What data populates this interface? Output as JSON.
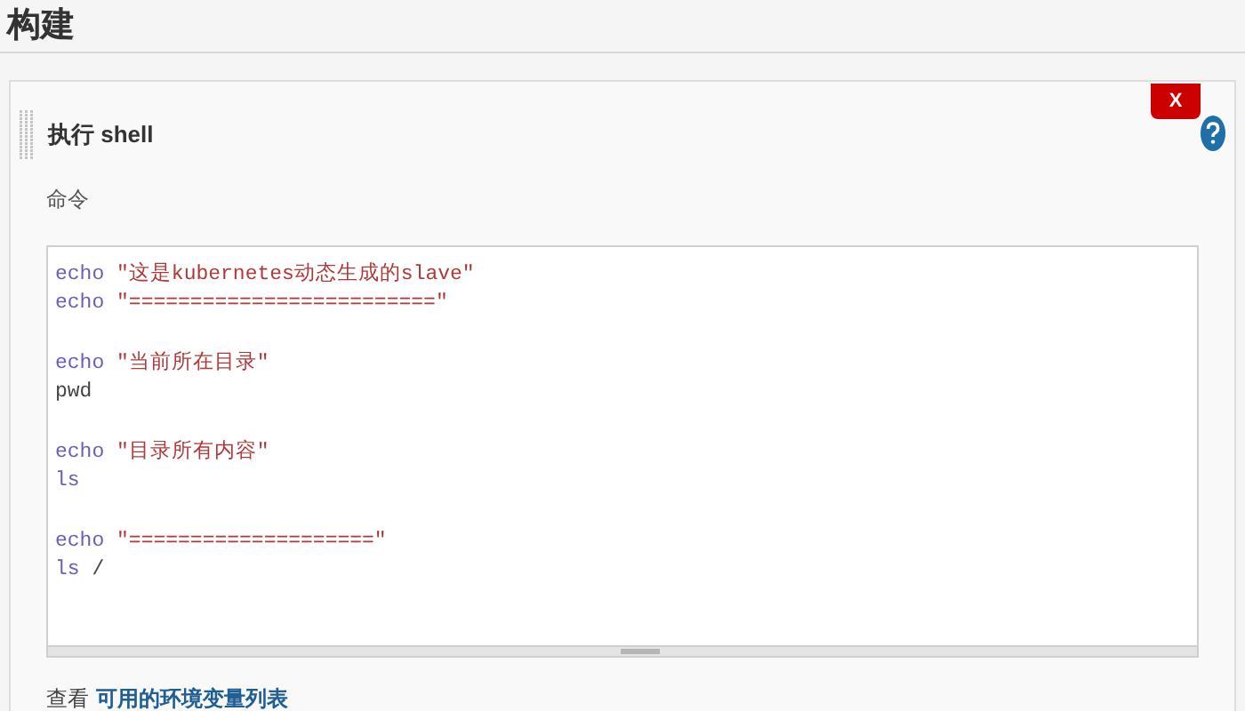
{
  "section_title": "构建",
  "step": {
    "title": "执行 shell",
    "delete_button": "X",
    "field_label": "命令",
    "code_blocks": [
      [
        [
          {
            "kind": "command",
            "text": "echo"
          },
          {
            "kind": "string",
            "text": "\"这是kubernetes动态生成的slave\""
          }
        ],
        [
          {
            "kind": "command",
            "text": "echo"
          },
          {
            "kind": "string",
            "text": "\"=========================\""
          }
        ]
      ],
      [
        [
          {
            "kind": "command",
            "text": "echo"
          },
          {
            "kind": "string",
            "text": "\"当前所在目录\""
          }
        ],
        [
          {
            "kind": "plain",
            "text": "pwd"
          }
        ]
      ],
      [
        [
          {
            "kind": "command",
            "text": "echo"
          },
          {
            "kind": "string",
            "text": "\"目录所有内容\""
          }
        ],
        [
          {
            "kind": "command",
            "text": "ls"
          }
        ]
      ],
      [
        [
          {
            "kind": "command",
            "text": "echo"
          },
          {
            "kind": "string",
            "text": "\"====================\""
          }
        ],
        [
          {
            "kind": "command",
            "text": "ls"
          },
          {
            "kind": "plain",
            "text": "/"
          }
        ]
      ]
    ],
    "footer_text": "查看",
    "footer_link": "可用的环境变量列表"
  }
}
